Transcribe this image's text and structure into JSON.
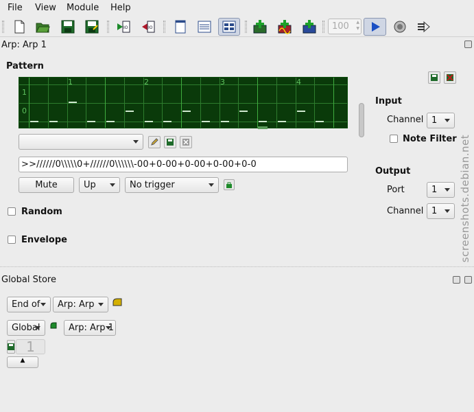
{
  "menu": [
    "File",
    "View",
    "Module",
    "Help"
  ],
  "toolbar": {
    "tempo_value": "100",
    "icons": [
      "new-file-icon",
      "open-file-icon",
      "save-icon",
      "save-as-icon",
      "import-midi-icon",
      "export-midi-icon",
      "view-single-icon",
      "view-list-icon",
      "view-grid-icon",
      "add-arp-icon",
      "add-lfo-icon",
      "add-seq-icon",
      "play-icon",
      "midi-clock-icon",
      "midi-control-icon"
    ]
  },
  "window_title": "Arp: Arp 1",
  "pattern": {
    "title": "Pattern",
    "y_labels": [
      "1",
      "0"
    ],
    "beats": [
      "1",
      "2",
      "3",
      "4"
    ],
    "text": ">>//////0\\\\\\\\\\0+//////0\\\\\\\\\\\\-00+0-00+0-00+0-00+0-0",
    "preset_value": "",
    "mute_label": "Mute",
    "direction_value": "Up",
    "trigger_value": "No trigger",
    "random_label": "Random",
    "envelope_label": "Envelope"
  },
  "input": {
    "title": "Input",
    "channel_label": "Channel",
    "channel_value": "1",
    "note_filter_label": "Note Filter"
  },
  "output": {
    "title": "Output",
    "port_label": "Port",
    "port_value": "1",
    "channel_label": "Channel",
    "channel_value": "1"
  },
  "global_store": {
    "title": "Global Store",
    "end_of_value": "End of",
    "arp_target_value": "Arp: Arp",
    "global_value": "Global",
    "arp_target2_value": "Arp: Arp 1",
    "index_value": "1"
  },
  "watermark": "screenshots.debian.net",
  "colors": {
    "pattern_bg": "#0a3a0a",
    "grid": "#2e7d2e",
    "play_active": "#1a4fc4"
  }
}
